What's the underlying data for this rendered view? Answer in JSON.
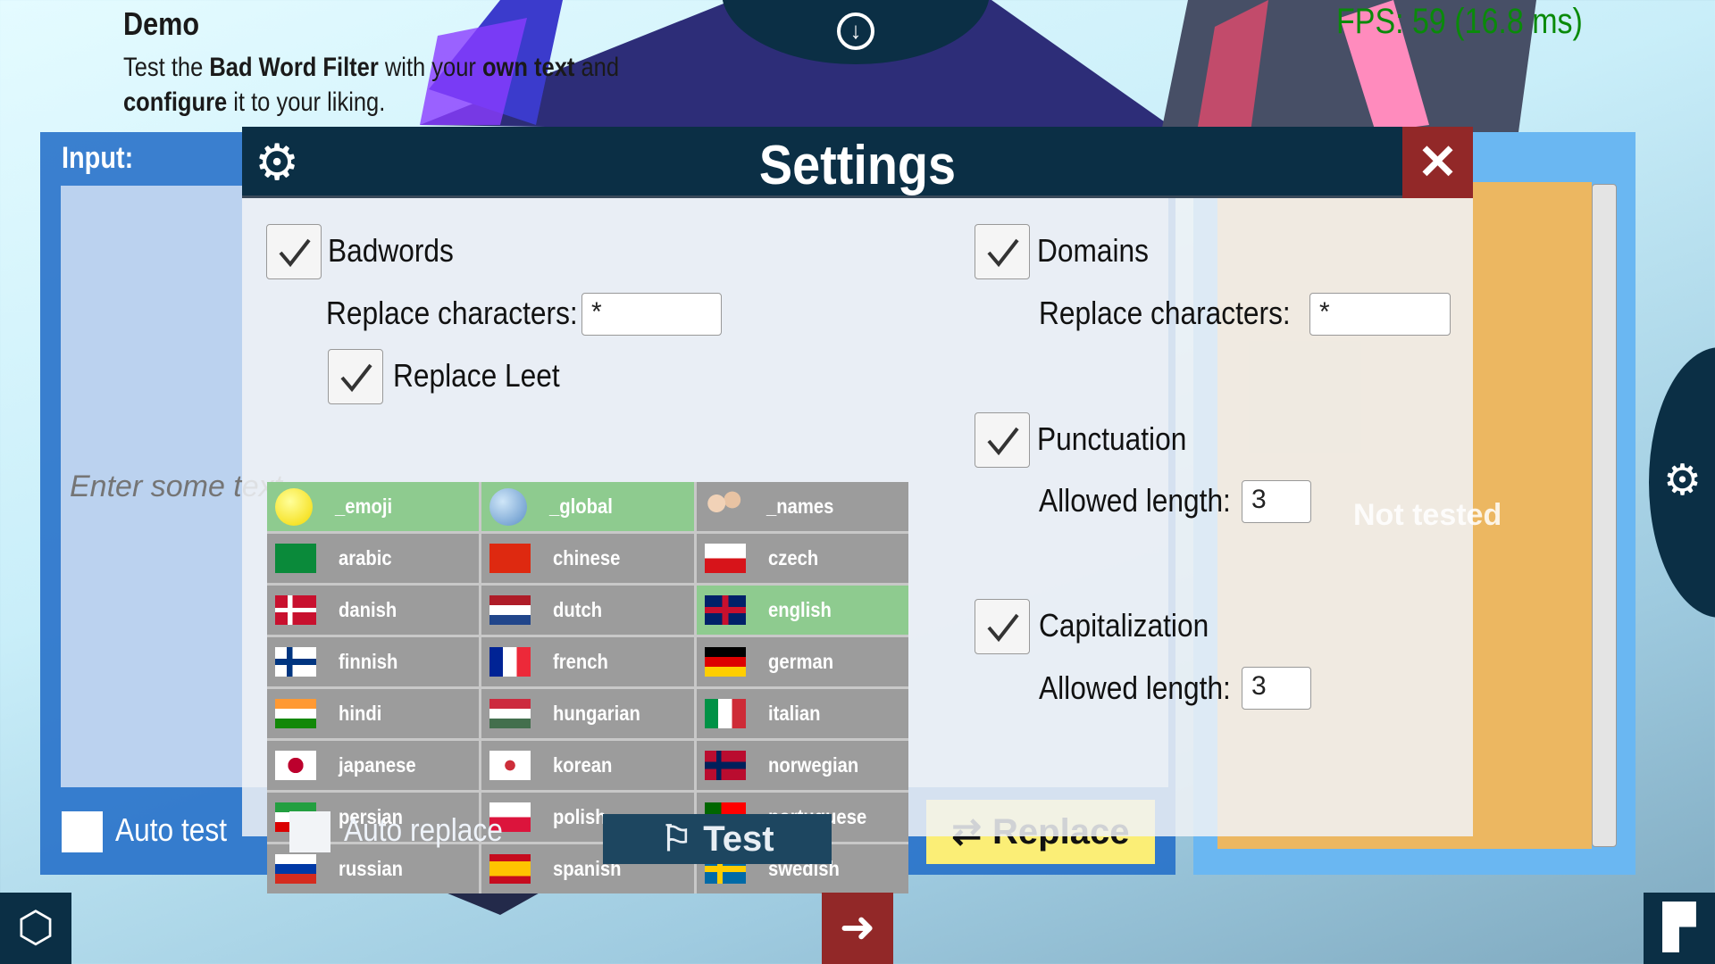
{
  "header": {
    "title": "Demo",
    "subtitle_parts": [
      "Test the ",
      "Bad Word Filter",
      " with your ",
      "own text",
      " and ",
      "configure",
      " it to your liking."
    ],
    "fps": "FPS: 59 (16.8 ms)"
  },
  "input": {
    "label": "Input:",
    "placeholder": "Enter some text..."
  },
  "output": {
    "status": "Not tested"
  },
  "bottom": {
    "auto_test": "Auto test",
    "auto_replace": "Auto replace",
    "test_button": "Test",
    "replace_button": "Replace"
  },
  "settings": {
    "title": "Settings",
    "badwords": {
      "label": "Badwords",
      "checked": true,
      "replace_label": "Replace characters:",
      "replace_value": "*",
      "leet_label": "Replace Leet",
      "leet_checked": true
    },
    "domains": {
      "label": "Domains",
      "checked": true,
      "replace_label": "Replace characters:",
      "replace_value": "*"
    },
    "punctuation": {
      "label": "Punctuation",
      "checked": true,
      "length_label": "Allowed length:",
      "length_value": "3"
    },
    "capitalization": {
      "label": "Capitalization",
      "checked": true,
      "length_label": "Allowed length:",
      "length_value": "3"
    },
    "languages": [
      {
        "name": "_emoji",
        "flag": "emoji",
        "selected": true
      },
      {
        "name": "_global",
        "flag": "global",
        "selected": true
      },
      {
        "name": "_names",
        "flag": "names",
        "selected": false
      },
      {
        "name": "arabic",
        "flag": "sa",
        "selected": false
      },
      {
        "name": "chinese",
        "flag": "cn",
        "selected": false
      },
      {
        "name": "czech",
        "flag": "cz",
        "selected": false
      },
      {
        "name": "danish",
        "flag": "dk",
        "selected": false
      },
      {
        "name": "dutch",
        "flag": "nl",
        "selected": false
      },
      {
        "name": "english",
        "flag": "gb",
        "selected": true
      },
      {
        "name": "finnish",
        "flag": "fi",
        "selected": false
      },
      {
        "name": "french",
        "flag": "fr",
        "selected": false
      },
      {
        "name": "german",
        "flag": "de",
        "selected": false
      },
      {
        "name": "hindi",
        "flag": "in",
        "selected": false
      },
      {
        "name": "hungarian",
        "flag": "hu",
        "selected": false
      },
      {
        "name": "italian",
        "flag": "it",
        "selected": false
      },
      {
        "name": "japanese",
        "flag": "jp",
        "selected": false
      },
      {
        "name": "korean",
        "flag": "kr",
        "selected": false
      },
      {
        "name": "norwegian",
        "flag": "no",
        "selected": false
      },
      {
        "name": "persian",
        "flag": "ir",
        "selected": false
      },
      {
        "name": "polish",
        "flag": "pl",
        "selected": false
      },
      {
        "name": "portuguese",
        "flag": "pt",
        "selected": false
      },
      {
        "name": "russian",
        "flag": "ru",
        "selected": false
      },
      {
        "name": "spanish",
        "flag": "es",
        "selected": false
      },
      {
        "name": "swedish",
        "flag": "se",
        "selected": false
      }
    ]
  },
  "icons": {
    "download": "download-circle-icon",
    "settings": "gear-icon",
    "close": "close-icon",
    "test": "flag-icon",
    "replace": "swap-arrows-icon",
    "unity": "unity-logo-icon",
    "exit": "exit-icon",
    "crosstales": "crosstales-logo-icon"
  },
  "colors": {
    "dark": "#0b2f45",
    "close": "#922828",
    "selected": "#8ecb8f",
    "unselected": "#9c9c9c",
    "fps": "#0a8a0a",
    "replace": "#fbee76",
    "output": "#ecb761"
  }
}
